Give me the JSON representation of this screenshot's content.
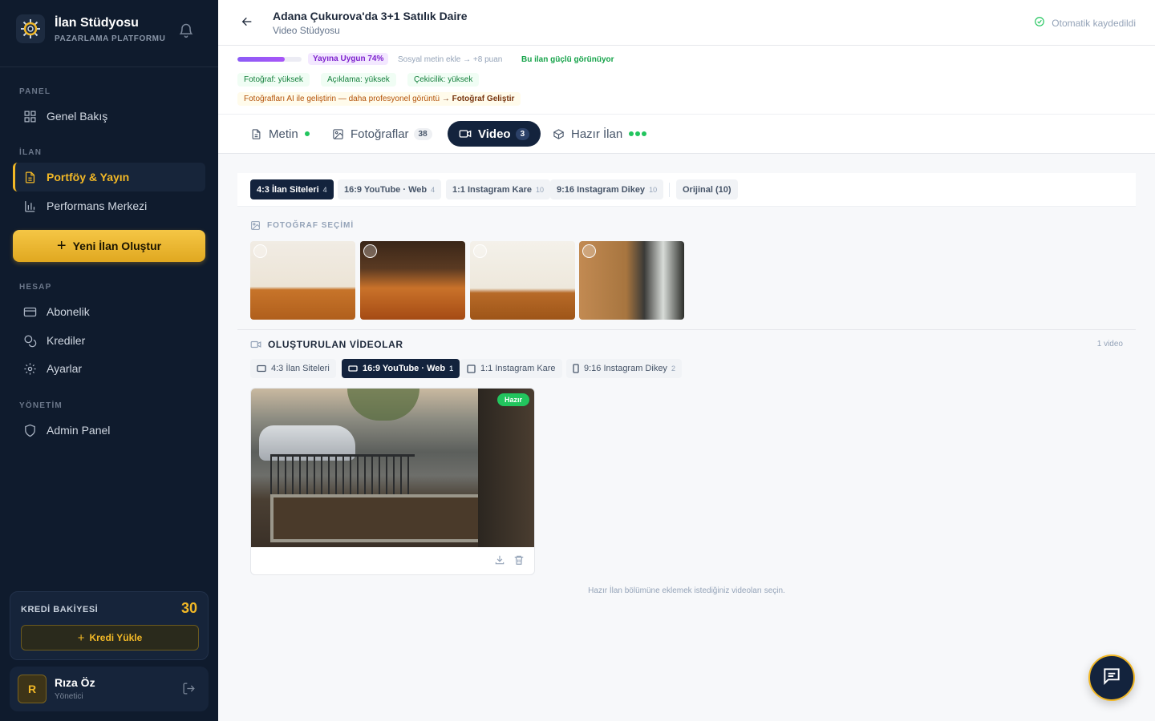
{
  "brand": {
    "title": "İlan Stüdyosu",
    "subtitle": "PAZARLAMA PLATFORMU"
  },
  "sidebar": {
    "sections": {
      "panel": "PANEL",
      "ilan": "İLAN",
      "hesap": "HESAP",
      "yonetim": "YÖNETİM"
    },
    "items": {
      "genel_bakis": "Genel Bakış",
      "portfoy": "Portföy & Yayın",
      "performans": "Performans Merkezi",
      "abonelik": "Abonelik",
      "krediler": "Krediler",
      "ayarlar": "Ayarlar",
      "admin": "Admin Panel"
    },
    "new_listing": "Yeni İlan Oluştur",
    "credit": {
      "label": "KREDİ BAKİYESİ",
      "value": "30",
      "button": "Kredi Yükle"
    },
    "user": {
      "initial": "R",
      "name": "Rıza Öz",
      "role": "Yönetici"
    }
  },
  "header": {
    "title": "Adana Çukurova'da 3+1 Satılık Daire",
    "subtitle": "Video Stüdyosu",
    "autosave": "Otomatik kaydedildi"
  },
  "status": {
    "progress_percent": 74,
    "ready_label": "Yayına Uygun 74%",
    "hint": "Sosyal metin ekle → +8 puan",
    "strong": "Bu ilan güçlü görünüyor",
    "chips": [
      "Fotoğraf: yüksek",
      "Açıklama: yüksek",
      "Çekicilik: yüksek"
    ],
    "ai_tip": "Fotoğrafları AI ile geliştirin — daha profesyonel görüntü",
    "ai_tip_action": "→ Fotoğraf Geliştir"
  },
  "tabs": {
    "metin": "Metin",
    "fotograflar": "Fotoğraflar",
    "fotograflar_count": "38",
    "video": "Video",
    "video_count": "3",
    "hazir": "Hazır İlan"
  },
  "ratios": [
    {
      "label": "4:3 İlan Siteleri",
      "n": "4"
    },
    {
      "label": "16:9 YouTube · Web",
      "n": "4"
    },
    {
      "label": "1:1 Instagram Kare",
      "n": "10"
    },
    {
      "label": "9:16 Instagram Dikey",
      "n": "10"
    },
    {
      "label": "Orijinal (10)",
      "n": ""
    }
  ],
  "photo_section": {
    "label": "FOTOĞRAF SEÇİMİ"
  },
  "videos": {
    "title": "OLUŞTURULAN VİDEOLAR",
    "count": "1 video",
    "filters": [
      {
        "label": "4:3 İlan Siteleri",
        "n": ""
      },
      {
        "label": "16:9 YouTube · Web",
        "n": "1"
      },
      {
        "label": "1:1 Instagram Kare",
        "n": ""
      },
      {
        "label": "9:16 Instagram Dikey",
        "n": "2"
      }
    ],
    "card_status": "Hazır"
  },
  "footer_hint": "Hazır İlan bölümüne eklemek istediğiniz videoları seçin.",
  "colors": {
    "accent": "#f2b826",
    "navy": "#13233d",
    "sidebar": "#0f1b2d",
    "success": "#22c55e",
    "purple": "#8b5cf6"
  }
}
